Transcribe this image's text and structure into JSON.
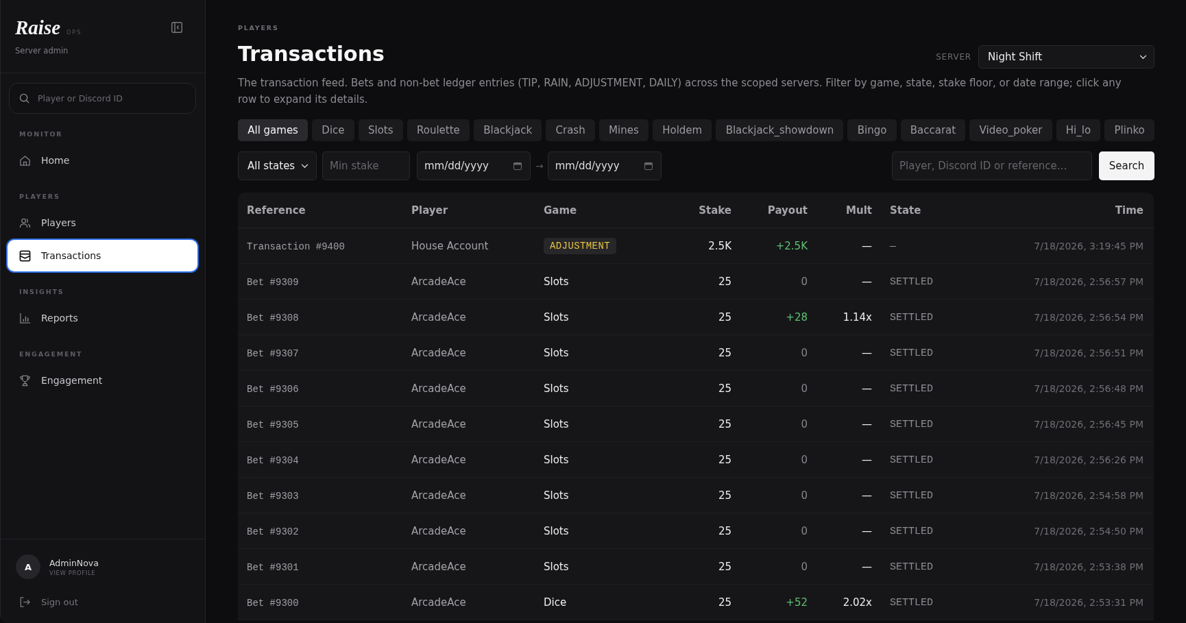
{
  "sidebar": {
    "logo": {
      "name": "Raise",
      "tag": "OPS"
    },
    "subtitle": "Server admin",
    "search": {
      "placeholder": "Player or Discord ID"
    },
    "sections": [
      {
        "heading": "MONITOR",
        "items": [
          {
            "label": "Home",
            "selected": false
          }
        ]
      },
      {
        "heading": "PLAYERS",
        "items": [
          {
            "label": "Players",
            "selected": false
          },
          {
            "label": "Transactions",
            "selected": true
          }
        ]
      },
      {
        "heading": "INSIGHTS",
        "items": [
          {
            "label": "Reports",
            "selected": false
          }
        ]
      },
      {
        "heading": "ENGAGEMENT",
        "items": [
          {
            "label": "Engagement",
            "selected": false
          }
        ]
      }
    ],
    "user": {
      "initial": "A",
      "name": "AdminNova",
      "link": "VIEW PROFILE"
    },
    "sign_out": "Sign out"
  },
  "breadcrumb": "PLAYERS",
  "title": "Transactions",
  "server": {
    "label": "SERVER",
    "value": "Night Shift"
  },
  "description": "The transaction feed. Bets and non-bet ledger entries (TIP, RAIN, ADJUSTMENT, DAILY) across the scoped servers. Filter by game, state, stake floor, or date range; click any row to expand its details.",
  "game_filters": [
    {
      "label": "All games",
      "selected": true
    },
    {
      "label": "Dice",
      "selected": false
    },
    {
      "label": "Slots",
      "selected": false
    },
    {
      "label": "Roulette",
      "selected": false
    },
    {
      "label": "Blackjack",
      "selected": false
    },
    {
      "label": "Crash",
      "selected": false
    },
    {
      "label": "Mines",
      "selected": false
    },
    {
      "label": "Holdem",
      "selected": false
    },
    {
      "label": "Blackjack_showdown",
      "selected": false
    },
    {
      "label": "Bingo",
      "selected": false
    },
    {
      "label": "Baccarat",
      "selected": false
    },
    {
      "label": "Video_poker",
      "selected": false
    },
    {
      "label": "Hi_lo",
      "selected": false
    },
    {
      "label": "Plinko",
      "selected": false
    }
  ],
  "filters": {
    "state": {
      "value": "All states"
    },
    "min_stake": {
      "placeholder": "Min stake"
    },
    "date_from": {
      "placeholder": "mm/dd/yyyy"
    },
    "range_arrow": "→",
    "date_to": {
      "placeholder": "mm/dd/yyyy"
    },
    "search": {
      "placeholder": "Player, Discord ID or reference..."
    },
    "search_button": "Search"
  },
  "table": {
    "columns": [
      "Reference",
      "Player",
      "Game",
      "Stake",
      "Payout",
      "Mult",
      "State",
      "Time"
    ],
    "rows": [
      {
        "reference": "Transaction #9400",
        "player": "House Account",
        "game": {
          "text": "ADJUSTMENT",
          "kind": "tag"
        },
        "stake": "2.5K",
        "payout": {
          "text": "+2.5K",
          "kind": "gain"
        },
        "mult": "—",
        "state": "—",
        "time": "7/18/2026, 3:19:45 PM"
      },
      {
        "reference": "Bet #9309",
        "player": "ArcadeAce",
        "game": {
          "text": "Slots",
          "kind": "plain"
        },
        "stake": "25",
        "payout": {
          "text": "0",
          "kind": "zero"
        },
        "mult": "—",
        "state": "SETTLED",
        "time": "7/18/2026, 2:56:57 PM"
      },
      {
        "reference": "Bet #9308",
        "player": "ArcadeAce",
        "game": {
          "text": "Slots",
          "kind": "plain"
        },
        "stake": "25",
        "payout": {
          "text": "+28",
          "kind": "gain"
        },
        "mult": "1.14x",
        "state": "SETTLED",
        "time": "7/18/2026, 2:56:54 PM"
      },
      {
        "reference": "Bet #9307",
        "player": "ArcadeAce",
        "game": {
          "text": "Slots",
          "kind": "plain"
        },
        "stake": "25",
        "payout": {
          "text": "0",
          "kind": "zero"
        },
        "mult": "—",
        "state": "SETTLED",
        "time": "7/18/2026, 2:56:51 PM"
      },
      {
        "reference": "Bet #9306",
        "player": "ArcadeAce",
        "game": {
          "text": "Slots",
          "kind": "plain"
        },
        "stake": "25",
        "payout": {
          "text": "0",
          "kind": "zero"
        },
        "mult": "—",
        "state": "SETTLED",
        "time": "7/18/2026, 2:56:48 PM"
      },
      {
        "reference": "Bet #9305",
        "player": "ArcadeAce",
        "game": {
          "text": "Slots",
          "kind": "plain"
        },
        "stake": "25",
        "payout": {
          "text": "0",
          "kind": "zero"
        },
        "mult": "—",
        "state": "SETTLED",
        "time": "7/18/2026, 2:56:45 PM"
      },
      {
        "reference": "Bet #9304",
        "player": "ArcadeAce",
        "game": {
          "text": "Slots",
          "kind": "plain"
        },
        "stake": "25",
        "payout": {
          "text": "0",
          "kind": "zero"
        },
        "mult": "—",
        "state": "SETTLED",
        "time": "7/18/2026, 2:56:26 PM"
      },
      {
        "reference": "Bet #9303",
        "player": "ArcadeAce",
        "game": {
          "text": "Slots",
          "kind": "plain"
        },
        "stake": "25",
        "payout": {
          "text": "0",
          "kind": "zero"
        },
        "mult": "—",
        "state": "SETTLED",
        "time": "7/18/2026, 2:54:58 PM"
      },
      {
        "reference": "Bet #9302",
        "player": "ArcadeAce",
        "game": {
          "text": "Slots",
          "kind": "plain"
        },
        "stake": "25",
        "payout": {
          "text": "0",
          "kind": "zero"
        },
        "mult": "—",
        "state": "SETTLED",
        "time": "7/18/2026, 2:54:50 PM"
      },
      {
        "reference": "Bet #9301",
        "player": "ArcadeAce",
        "game": {
          "text": "Slots",
          "kind": "plain"
        },
        "stake": "25",
        "payout": {
          "text": "0",
          "kind": "zero"
        },
        "mult": "—",
        "state": "SETTLED",
        "time": "7/18/2026, 2:53:38 PM"
      },
      {
        "reference": "Bet #9300",
        "player": "ArcadeAce",
        "game": {
          "text": "Dice",
          "kind": "plain"
        },
        "stake": "25",
        "payout": {
          "text": "+52",
          "kind": "gain"
        },
        "mult": "2.02x",
        "state": "SETTLED",
        "time": "7/18/2026, 2:53:31 PM"
      }
    ]
  }
}
